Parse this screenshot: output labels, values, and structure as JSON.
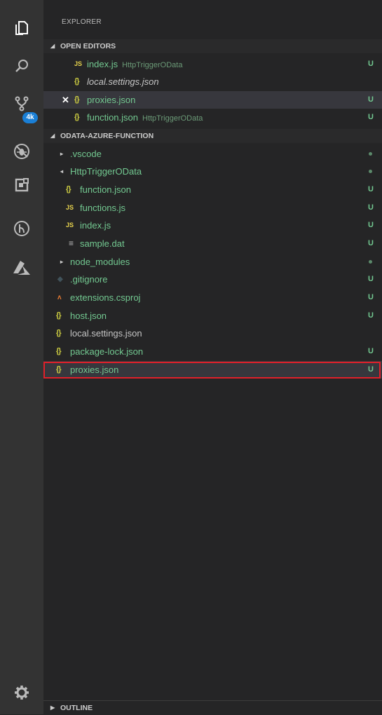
{
  "explorer": {
    "title": "EXPLORER"
  },
  "activity_bar": {
    "items": [
      {
        "icon": "files-icon"
      },
      {
        "icon": "search-icon"
      },
      {
        "icon": "source-control-icon",
        "badge": "4k"
      },
      {
        "icon": "debug-icon"
      },
      {
        "icon": "extensions-icon"
      },
      {
        "icon": "timeline-icon"
      },
      {
        "icon": "azure-icon"
      }
    ],
    "settings_icon": "gear-icon"
  },
  "open_editors": {
    "header": "OPEN EDITORS",
    "items": [
      {
        "icon": "JS",
        "name": "index.js",
        "desc": "HttpTriggerOData",
        "status": "U"
      },
      {
        "icon": "{}",
        "name": "local.settings.json",
        "desc": "",
        "status": ""
      },
      {
        "icon": "{}",
        "name": "proxies.json",
        "desc": "",
        "status": "U"
      },
      {
        "icon": "{}",
        "name": "function.json",
        "desc": "HttpTriggerOData",
        "status": "U"
      }
    ]
  },
  "workspace": {
    "header": "ODATA-AZURE-FUNCTION",
    "items": [
      {
        "icon": "▸",
        "name": ".vscode"
      },
      {
        "icon": "◂",
        "name": "HttpTriggerOData"
      },
      {
        "icon": "{}",
        "name": "function.json",
        "status": "U"
      },
      {
        "icon": "JS",
        "name": "functions.js",
        "status": "U"
      },
      {
        "icon": "JS",
        "name": "index.js",
        "status": "U"
      },
      {
        "icon": "≡",
        "name": "sample.dat",
        "status": "U"
      },
      {
        "icon": "▸",
        "name": "node_modules"
      },
      {
        "icon": "◆",
        "name": ".gitignore",
        "status": "U"
      },
      {
        "icon": "ʌ",
        "name": "extensions.csproj",
        "status": "U"
      },
      {
        "icon": "{}",
        "name": "host.json",
        "status": "U"
      },
      {
        "icon": "{}",
        "name": "local.settings.json",
        "status": ""
      },
      {
        "icon": "{}",
        "name": "package-lock.json",
        "status": "U"
      },
      {
        "icon": "{}",
        "name": "proxies.json",
        "status": "U"
      }
    ]
  },
  "outline": {
    "header": "OUTLINE"
  },
  "colors": {
    "activity_bg": "#333333",
    "sidebar_bg": "#252526",
    "untracked": "#73c991",
    "highlight": "#e0202a",
    "badge": "#1a7fd6"
  }
}
